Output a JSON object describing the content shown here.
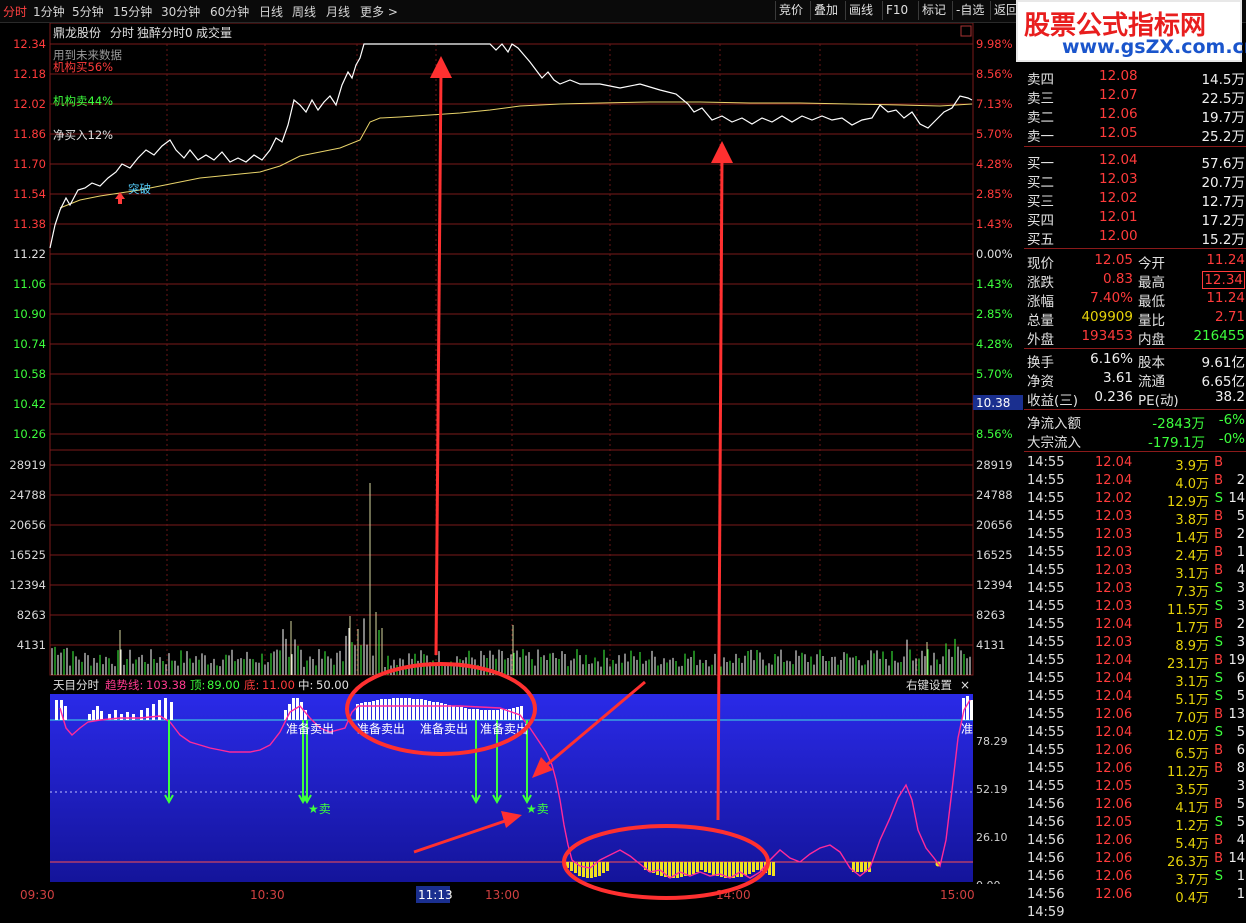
{
  "topbar": {
    "periods": [
      "分时",
      "1分钟",
      "5分钟",
      "15分钟",
      "30分钟",
      "60分钟",
      "日线",
      "周线",
      "月线",
      "更多 >"
    ],
    "tools": [
      "竞价",
      "叠加",
      "画线",
      "F10",
      "标记",
      "-自选",
      "返回"
    ]
  },
  "logo": {
    "title": "股票公式指标网",
    "url": "www.gsZX.com.cn"
  },
  "chart_header": {
    "name": "鼎龙股份",
    "mode": "分时",
    "indicator": "独醉分时0",
    "volume": "成交量",
    "legend": [
      "用到未来数据",
      "机构买56%",
      "机构卖44%",
      "净买入12%"
    ],
    "breakout": "突破"
  },
  "price_axis": {
    "left": [
      "12.34",
      "12.18",
      "12.02",
      "11.86",
      "11.70",
      "11.54",
      "11.38",
      "11.22",
      "11.06",
      "10.90",
      "10.74",
      "10.58",
      "10.42",
      "10.26"
    ],
    "right": [
      "9.98%",
      "8.56%",
      "7.13%",
      "5.70%",
      "4.28%",
      "2.85%",
      "1.43%",
      "0.00%",
      "1.43%",
      "2.85%",
      "4.28%",
      "5.70%",
      "",
      "8.56%"
    ],
    "current": "10.38"
  },
  "volume_axis": [
    "28919",
    "24788",
    "20656",
    "16525",
    "12394",
    "8263",
    "4131"
  ],
  "indicator_panel": {
    "name": "天目分时",
    "trend_label": "趋势线:",
    "trend_value": "103.38",
    "top_label": "顶:",
    "top_value": "89.00",
    "bottom_label": "底:",
    "bottom_value": "11.00",
    "mid_label": "中:",
    "mid_value": "50.00",
    "settings": "右键设置",
    "close": "×",
    "axis": [
      "78.29",
      "52.19",
      "26.10",
      "0.00"
    ],
    "signals": [
      "准备卖出",
      "准备卖出",
      "准备卖出",
      "准备卖出",
      "准"
    ],
    "sell": [
      "★卖",
      "★卖"
    ]
  },
  "time_axis": [
    "09:30",
    "10:30",
    "11:13",
    "13:00",
    "14:00",
    "15:00"
  ],
  "order_book": {
    "asks": [
      {
        "label": "卖四",
        "price": "12.08",
        "vol": "14.5万"
      },
      {
        "label": "卖三",
        "price": "12.07",
        "vol": "22.5万"
      },
      {
        "label": "卖二",
        "price": "12.06",
        "vol": "19.7万"
      },
      {
        "label": "卖一",
        "price": "12.05",
        "vol": "25.2万"
      }
    ],
    "bids": [
      {
        "label": "买一",
        "price": "12.04",
        "vol": "57.6万"
      },
      {
        "label": "买二",
        "price": "12.03",
        "vol": "20.7万"
      },
      {
        "label": "买三",
        "price": "12.02",
        "vol": "12.7万"
      },
      {
        "label": "买四",
        "price": "12.01",
        "vol": "17.2万"
      },
      {
        "label": "买五",
        "price": "12.00",
        "vol": "15.2万"
      }
    ]
  },
  "stats": {
    "rows": [
      {
        "l1": "现价",
        "v1": "12.05",
        "l2": "今开",
        "v2": "11.24"
      },
      {
        "l1": "涨跌",
        "v1": "0.83",
        "l2": "最高",
        "v2": "12.34"
      },
      {
        "l1": "涨幅",
        "v1": "7.40%",
        "l2": "最低",
        "v2": "11.24"
      },
      {
        "l1": "总量",
        "v1": "409909",
        "l2": "量比",
        "v2": "2.71"
      },
      {
        "l1": "外盘",
        "v1": "193453",
        "l2": "内盘",
        "v2": "216455"
      },
      {
        "l1": "换手",
        "v1": "6.16%",
        "l2": "股本",
        "v2": "9.61亿"
      },
      {
        "l1": "净资",
        "v1": "3.61",
        "l2": "流通",
        "v2": "6.65亿"
      },
      {
        "l1": "收益(三)",
        "v1": "0.236",
        "l2": "PE(动)",
        "v2": "38.2"
      }
    ],
    "flow": [
      {
        "label": "净流入额",
        "v1": "-2843万",
        "v2": "-6%"
      },
      {
        "label": "大宗流入",
        "v1": "-179.1万",
        "v2": "-0%"
      }
    ]
  },
  "ticks": [
    {
      "t": "14:55",
      "p": "12.04",
      "v": "3.9万",
      "s": "B",
      "n": ""
    },
    {
      "t": "14:55",
      "p": "12.04",
      "v": "4.0万",
      "s": "B",
      "n": "2"
    },
    {
      "t": "14:55",
      "p": "12.02",
      "v": "12.9万",
      "s": "S",
      "n": "14"
    },
    {
      "t": "14:55",
      "p": "12.03",
      "v": "3.8万",
      "s": "B",
      "n": "5"
    },
    {
      "t": "14:55",
      "p": "12.03",
      "v": "1.4万",
      "s": "B",
      "n": "2"
    },
    {
      "t": "14:55",
      "p": "12.03",
      "v": "2.4万",
      "s": "B",
      "n": "1"
    },
    {
      "t": "14:55",
      "p": "12.03",
      "v": "3.1万",
      "s": "B",
      "n": "4"
    },
    {
      "t": "14:55",
      "p": "12.03",
      "v": "7.3万",
      "s": "S",
      "n": "3"
    },
    {
      "t": "14:55",
      "p": "12.03",
      "v": "11.5万",
      "s": "S",
      "n": "3"
    },
    {
      "t": "14:55",
      "p": "12.04",
      "v": "1.7万",
      "s": "B",
      "n": "2"
    },
    {
      "t": "14:55",
      "p": "12.03",
      "v": "8.9万",
      "s": "S",
      "n": "3"
    },
    {
      "t": "14:55",
      "p": "12.04",
      "v": "23.1万",
      "s": "B",
      "n": "19"
    },
    {
      "t": "14:55",
      "p": "12.04",
      "v": "3.1万",
      "s": "S",
      "n": "6"
    },
    {
      "t": "14:55",
      "p": "12.04",
      "v": "5.1万",
      "s": "S",
      "n": "5"
    },
    {
      "t": "14:55",
      "p": "12.06",
      "v": "7.0万",
      "s": "B",
      "n": "13"
    },
    {
      "t": "14:55",
      "p": "12.04",
      "v": "12.0万",
      "s": "S",
      "n": "5"
    },
    {
      "t": "14:55",
      "p": "12.06",
      "v": "6.5万",
      "s": "B",
      "n": "6"
    },
    {
      "t": "14:55",
      "p": "12.06",
      "v": "11.2万",
      "s": "B",
      "n": "8"
    },
    {
      "t": "14:55",
      "p": "12.05",
      "v": "3.5万",
      "s": "",
      "n": "3"
    },
    {
      "t": "14:56",
      "p": "12.06",
      "v": "4.1万",
      "s": "B",
      "n": "5"
    },
    {
      "t": "14:56",
      "p": "12.05",
      "v": "1.2万",
      "s": "S",
      "n": "5"
    },
    {
      "t": "14:56",
      "p": "12.06",
      "v": "5.4万",
      "s": "B",
      "n": "4"
    },
    {
      "t": "14:56",
      "p": "12.06",
      "v": "26.3万",
      "s": "B",
      "n": "14"
    },
    {
      "t": "14:56",
      "p": "12.06",
      "v": "3.7万",
      "s": "S",
      "n": "1"
    },
    {
      "t": "14:56",
      "p": "12.06",
      "v": "0.4万",
      "s": "",
      "n": "1"
    },
    {
      "t": "14:59",
      "p": "",
      "v": "",
      "s": "",
      "n": ""
    }
  ],
  "colors": {
    "up": "#ff3b3b",
    "down": "#3dff3d",
    "price_line": "#ffffff",
    "avg_line": "#e8d36a",
    "grid": "#7a1a1a",
    "annotation": "#ff3030",
    "indicator_bg": "#1b1bd8",
    "trend_line": "#ff2a9a"
  }
}
